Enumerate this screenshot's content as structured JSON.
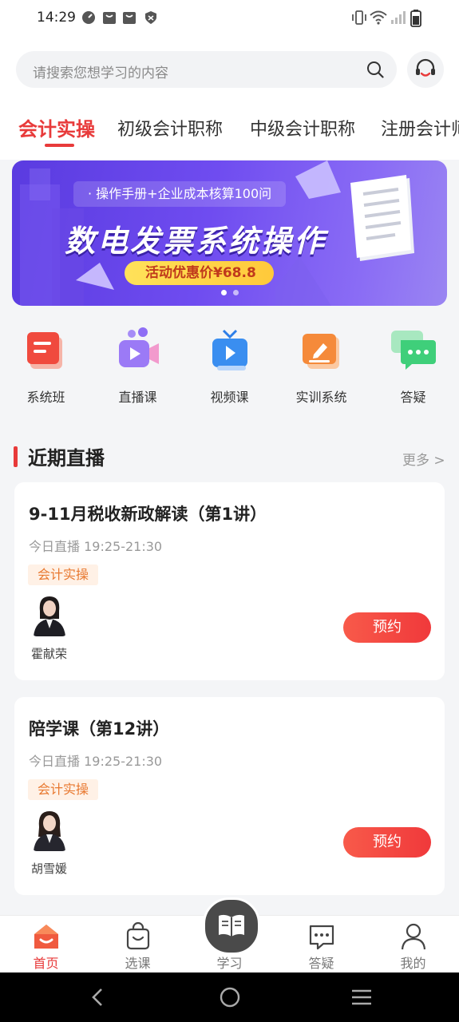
{
  "status_bar": {
    "time": "14:29"
  },
  "search": {
    "placeholder": "请搜索您想学习的内容"
  },
  "tabs": [
    {
      "label": "会计实操",
      "active": true
    },
    {
      "label": "初级会计职称",
      "active": false
    },
    {
      "label": "中级会计职称",
      "active": false
    },
    {
      "label": "注册会计师",
      "active": false
    }
  ],
  "banner": {
    "subtitle": "· 操作手册+企业成本核算100问",
    "title": "数电发票系统操作",
    "price_label": "活动优惠价¥68.8",
    "slide_count": 2,
    "current_slide": 1
  },
  "quick_menu": [
    {
      "label": "系统班",
      "icon": "book-icon"
    },
    {
      "label": "直播课",
      "icon": "video-camera-icon"
    },
    {
      "label": "视频课",
      "icon": "tv-play-icon"
    },
    {
      "label": "实训系统",
      "icon": "edit-icon"
    },
    {
      "label": "答疑",
      "icon": "chat-icon"
    }
  ],
  "section": {
    "title": "近期直播",
    "more": "更多 >"
  },
  "live_courses": [
    {
      "title": "9-11月税收新政解读（第1讲）",
      "time": "今日直播 19:25-21:30",
      "tag": "会计实操",
      "teacher": "霍献荣",
      "button": "预约"
    },
    {
      "title": "陪学课（第12讲）",
      "time": "今日直播 19:25-21:30",
      "tag": "会计实操",
      "teacher": "胡雪媛",
      "button": "预约"
    }
  ],
  "tabbar": [
    {
      "label": "首页",
      "icon": "home-icon",
      "active": true
    },
    {
      "label": "选课",
      "icon": "shopping-bag-icon",
      "active": false
    },
    {
      "label": "学习",
      "icon": "open-book-icon",
      "active": false
    },
    {
      "label": "答疑",
      "icon": "message-icon",
      "active": false
    },
    {
      "label": "我的",
      "icon": "user-icon",
      "active": false
    }
  ],
  "colors": {
    "accent": "#e83a3a",
    "banner": "#6f4cf0",
    "tag": "#e8782f"
  }
}
